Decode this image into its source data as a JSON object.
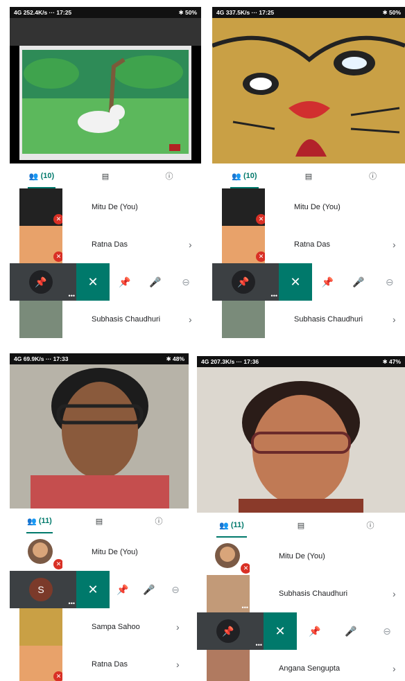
{
  "panels": [
    {
      "status": {
        "left": "4G  252.4K/s  ··· 17:25",
        "right": "✱ 50%"
      },
      "tabs": {
        "people": "(10)"
      },
      "participants": [
        {
          "name": "Mitu De (You)",
          "muted": true,
          "chevron": ""
        },
        {
          "name": "Ratna Das",
          "muted": true,
          "chevron": "›"
        }
      ],
      "after": [
        {
          "name": "Subhasis Chaudhuri",
          "chevron": "›"
        }
      ]
    },
    {
      "status": {
        "left": "4G  337.5K/s  ··· 17:25",
        "right": "✱ 50%"
      },
      "tabs": {
        "people": "(10)"
      },
      "participants": [
        {
          "name": "Mitu De (You)",
          "muted": true,
          "chevron": ""
        },
        {
          "name": "Ratna Das",
          "muted": true,
          "chevron": "›"
        }
      ],
      "after": [
        {
          "name": "Subhasis Chaudhuri",
          "chevron": "›"
        }
      ]
    },
    {
      "status": {
        "left": "4G  69.9K/s  ··· 17:33",
        "right": "✱ 48%"
      },
      "tabs": {
        "people": "(11)"
      },
      "participants": [
        {
          "name": "Mitu De (You)",
          "muted": true,
          "chevron": ""
        }
      ],
      "after": [
        {
          "name": "Sampa Sahoo",
          "chevron": "›"
        },
        {
          "name": "Ratna Das",
          "chevron": "›"
        }
      ]
    },
    {
      "status": {
        "left": "4G  207.3K/s  ··· 17:36",
        "right": "✱ 47%"
      },
      "tabs": {
        "people": "(11)"
      },
      "participants": [
        {
          "name": "Mitu De (You)",
          "muted": true,
          "chevron": ""
        },
        {
          "name": "Subhasis Chaudhuri",
          "muted": false,
          "chevron": "›"
        }
      ],
      "after": [
        {
          "name": "Angana Sengupta",
          "chevron": "›"
        }
      ]
    }
  ],
  "icons": {
    "people": "people-icon",
    "chat": "chat-icon",
    "info": "info-icon",
    "pin": "pin-icon",
    "mute": "mic-off-icon",
    "remove": "remove-icon",
    "close": "close-icon"
  },
  "colors": {
    "accent": "#00796b",
    "mute": "#d93025"
  }
}
